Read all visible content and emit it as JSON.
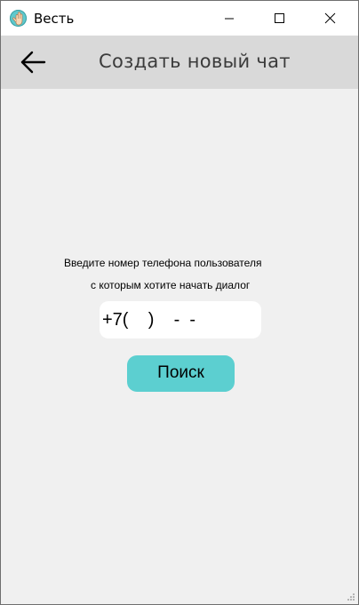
{
  "window": {
    "title": "Весть"
  },
  "titlebar_buttons": {
    "minimize_icon": "minimize-icon",
    "maximize_icon": "maximize-icon",
    "close_icon": "close-icon"
  },
  "header": {
    "back_icon": "arrow-left-icon",
    "title": "Создать новый чат"
  },
  "prompt": {
    "line1": "Введите номер телефона пользователя",
    "line2": "с которым хотите начать диалог"
  },
  "phone_input": {
    "value": "+7(    )    -  -"
  },
  "search_button": {
    "label": "Поиск"
  },
  "colors": {
    "accent": "#5ccfd0",
    "header_bg": "#d9d9d9",
    "content_bg": "#f0f0f0"
  }
}
